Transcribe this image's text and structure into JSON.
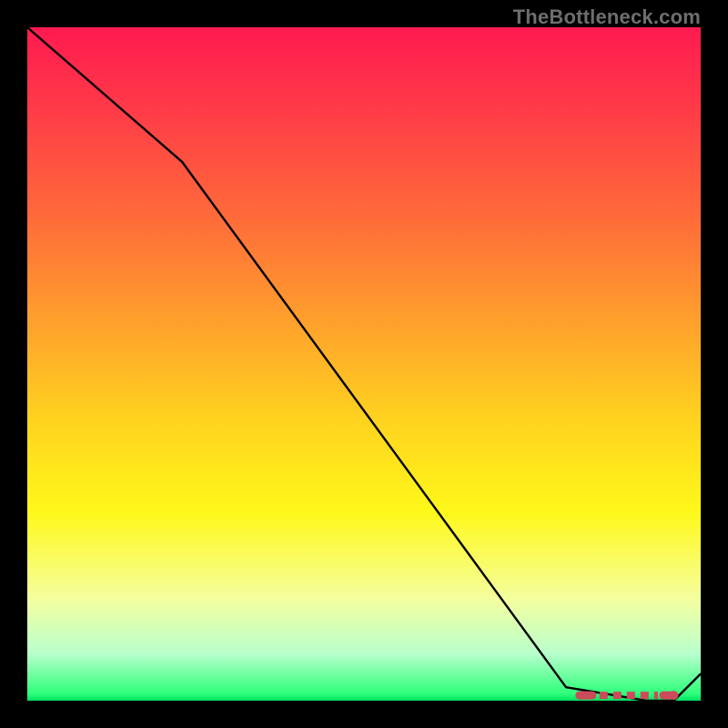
{
  "watermark": "TheBottleneck.com",
  "colors": {
    "line": "#000000",
    "dash": "#CC4B5A",
    "marker": "#CC4B5A"
  },
  "chart_data": {
    "type": "line",
    "title": "",
    "xlabel": "",
    "ylabel": "",
    "xlim": [
      0,
      100
    ],
    "ylim": [
      0,
      100
    ],
    "x": [
      0,
      23,
      80,
      92,
      96,
      100
    ],
    "values": [
      100,
      80,
      2,
      0,
      0,
      4
    ],
    "flat_segment": {
      "x_start": 82,
      "x_end": 95,
      "y": 0.8
    },
    "marker": {
      "x": 96,
      "y": 0.8
    }
  }
}
